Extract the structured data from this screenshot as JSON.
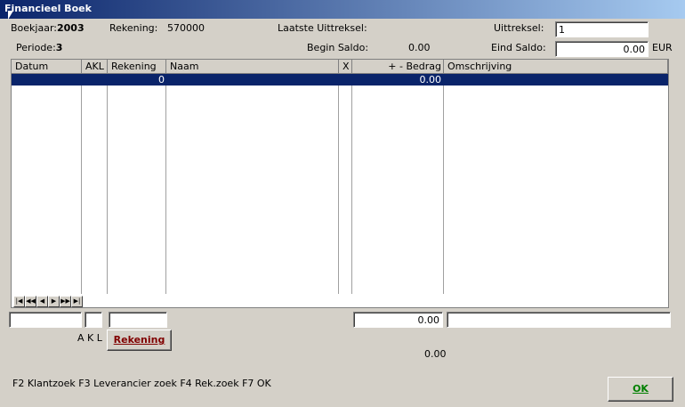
{
  "window": {
    "title": "Financieel Boek"
  },
  "header": {
    "boekjaar_label": "Boekjaar:",
    "boekjaar_value": "2003",
    "rekening_label": "Rekening:",
    "rekening_value": "570000",
    "laatste_label": "Laatste Uittreksel:",
    "uittreksel_label": "Uittreksel:",
    "uittreksel_value": "1",
    "periode_label": "Periode:",
    "periode_value": "3",
    "begin_saldo_label": "Begin Saldo:",
    "begin_saldo_value": "0.00",
    "eind_saldo_label": "Eind Saldo:",
    "eind_saldo_value": "0.00",
    "currency": "EUR"
  },
  "grid": {
    "columns": [
      "Datum",
      "AKL",
      "Rekening",
      "Naam",
      "X",
      "+ - Bedrag",
      "Omschrijving"
    ],
    "rows": [
      {
        "rekening": "0",
        "bedrag": "0.00"
      }
    ],
    "nav": [
      "|◀",
      "◀◀",
      "◀",
      "▶",
      "▶▶",
      "▶|"
    ]
  },
  "entry": {
    "bedrag_value": "0.00",
    "akl_label": "A K L",
    "rekening_button": "Rekening",
    "total": "0.00"
  },
  "footer": {
    "shortcuts": "F2 Klantzoek F3 Leverancier zoek F4 Rek.zoek  F7 OK",
    "ok_button": "OK"
  }
}
